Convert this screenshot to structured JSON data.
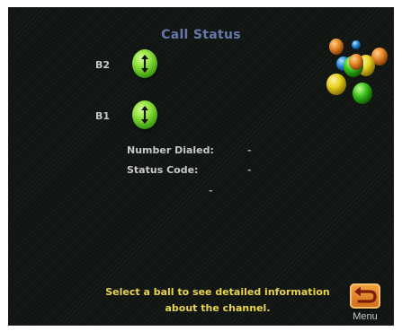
{
  "title": "Call Status",
  "channels": [
    {
      "label": "B2",
      "icon": "up-down-arrows-icon",
      "color": "#6fd62a"
    },
    {
      "label": "B1",
      "icon": "up-down-arrows-icon",
      "color": "#6fd62a"
    }
  ],
  "info": {
    "number_dialed_label": "Number Dialed:",
    "number_dialed_value": "-",
    "status_code_label": "Status Code:",
    "status_code_value": "-",
    "extra_value": "-"
  },
  "instruction": {
    "line1": "Select a ball to see detailed information",
    "line2": "about the channel."
  },
  "menu": {
    "label": "Menu",
    "icon": "return-arrow-icon"
  },
  "logo": {
    "icon": "balloons-logo-icon"
  },
  "colors": {
    "title": "#6677aa",
    "instruction": "#e8d44d",
    "background": "#111511",
    "accent": "#e8892a"
  }
}
